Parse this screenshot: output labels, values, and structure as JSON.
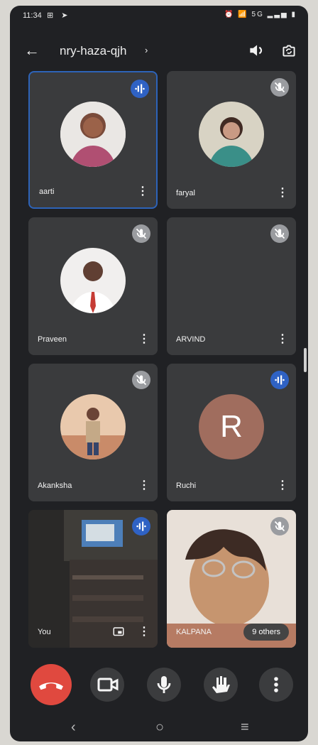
{
  "status_bar": {
    "time": "11:34",
    "left_icons": "⊞ ➤",
    "right_icons": "⏰ 📶 5G ▂▃▅ ▮"
  },
  "meeting": {
    "code": "nry-haza-qjh",
    "code_chevron": "›"
  },
  "participants": [
    {
      "name": "aarti",
      "state": "speaking"
    },
    {
      "name": "faryal",
      "state": "muted"
    },
    {
      "name": "Praveen",
      "state": "muted"
    },
    {
      "name": "ARVIND",
      "state": "muted"
    },
    {
      "name": "Akanksha",
      "state": "muted"
    },
    {
      "name": "Ruchi",
      "state": "speaking",
      "initial": "R"
    },
    {
      "name": "You",
      "state": "speaking"
    },
    {
      "name": "KALPANA",
      "state": "muted"
    }
  ],
  "others_count_label": "9 others",
  "colors": {
    "background": "#202124",
    "tile": "#3a3b3d",
    "active_border": "#2d63b8",
    "speaking_badge": "#2f62c4",
    "end_call": "#e0493f"
  },
  "controls": [
    {
      "name": "end-call"
    },
    {
      "name": "camera"
    },
    {
      "name": "microphone"
    },
    {
      "name": "raise-hand"
    },
    {
      "name": "more"
    }
  ],
  "nav": {
    "back": "‹",
    "home": "○",
    "recents": "≡"
  }
}
